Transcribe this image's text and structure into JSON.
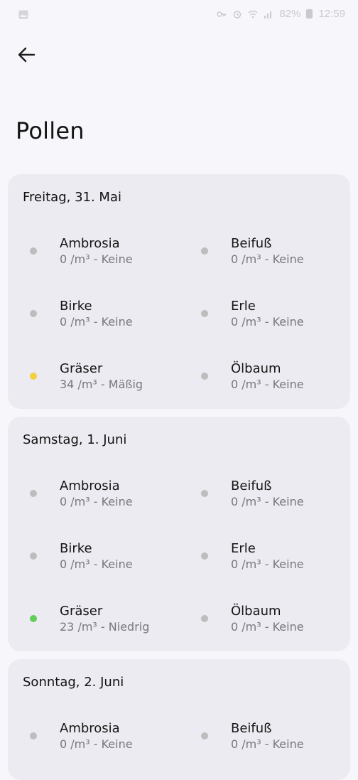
{
  "status_bar": {
    "battery": "82%",
    "time": "12:59"
  },
  "page": {
    "title": "Pollen"
  },
  "days": [
    {
      "title": "Freitag, 31. Mai",
      "items": [
        {
          "name": "Ambrosia",
          "value": "0 /m³ - Keine",
          "color": "#bdbdbd"
        },
        {
          "name": "Beifuß",
          "value": "0 /m³ - Keine",
          "color": "#bdbdbd"
        },
        {
          "name": "Birke",
          "value": "0 /m³ - Keine",
          "color": "#bdbdbd"
        },
        {
          "name": "Erle",
          "value": "0 /m³ - Keine",
          "color": "#bdbdbd"
        },
        {
          "name": "Gräser",
          "value": "34 /m³ - Mäßig",
          "color": "#f4cf3f"
        },
        {
          "name": "Ölbaum",
          "value": "0 /m³ - Keine",
          "color": "#bdbdbd"
        }
      ]
    },
    {
      "title": "Samstag, 1. Juni",
      "items": [
        {
          "name": "Ambrosia",
          "value": "0 /m³ - Keine",
          "color": "#bdbdbd"
        },
        {
          "name": "Beifuß",
          "value": "0 /m³ - Keine",
          "color": "#bdbdbd"
        },
        {
          "name": "Birke",
          "value": "0 /m³ - Keine",
          "color": "#bdbdbd"
        },
        {
          "name": "Erle",
          "value": "0 /m³ - Keine",
          "color": "#bdbdbd"
        },
        {
          "name": "Gräser",
          "value": "23 /m³ - Niedrig",
          "color": "#5fcf57"
        },
        {
          "name": "Ölbaum",
          "value": "0 /m³ - Keine",
          "color": "#bdbdbd"
        }
      ]
    },
    {
      "title": "Sonntag, 2. Juni",
      "items": [
        {
          "name": "Ambrosia",
          "value": "0 /m³ - Keine",
          "color": "#bdbdbd"
        },
        {
          "name": "Beifuß",
          "value": "0 /m³ - Keine",
          "color": "#bdbdbd"
        }
      ]
    }
  ]
}
